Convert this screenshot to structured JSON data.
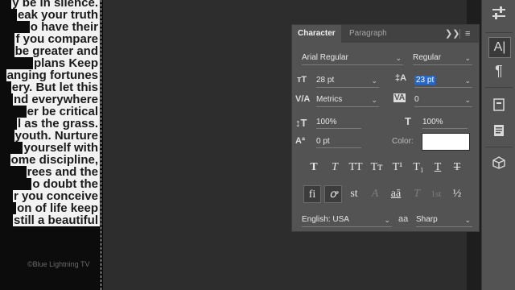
{
  "document": {
    "text_lines": [
      "y be in silence.",
      "eak your truth",
      "o have their",
      "f you compare",
      "be greater and",
      "plans Keep",
      "anging fortunes",
      "ery. But let this",
      "nd everywhere",
      "er be critical",
      "l as the grass.",
      "youth. Nurture",
      "yourself with",
      "ome discipline,",
      "rees and the",
      "o doubt the",
      "r you conceive",
      "on of life keep",
      "still a beautiful"
    ],
    "credit": "©Blue Lightning TV"
  },
  "panel": {
    "tabs": [
      {
        "label": "Character",
        "active": true
      },
      {
        "label": "Paragraph",
        "active": false
      }
    ],
    "collapse_icon": "double-chevron-right-icon",
    "menu_icon": "hamburger-menu-icon",
    "font_family": "Arial Regular",
    "font_style": "Regular",
    "font_size": "28 pt",
    "leading": "23 pt",
    "kerning": "Metrics",
    "tracking": "0",
    "vertical_scale": "100%",
    "horizontal_scale": "100%",
    "baseline_shift": "0 pt",
    "color_label": "Color:",
    "color_value": "#ffffff",
    "type_style_buttons": [
      "T",
      "T",
      "TT",
      "Tт",
      "T¹",
      "T₁",
      "T",
      "T"
    ],
    "opentype_buttons": [
      "fi",
      "ꝍ",
      "st",
      "A",
      "aā",
      "T",
      "1st",
      "½"
    ],
    "language": "English: USA",
    "antialias_icon_text": "aa",
    "antialias": "Sharp"
  },
  "dock": {
    "icons": [
      "adjustments-icon",
      "character-icon",
      "paragraph-icon",
      "glyphs-icon",
      "notes-icon",
      "3d-cube-icon"
    ]
  }
}
